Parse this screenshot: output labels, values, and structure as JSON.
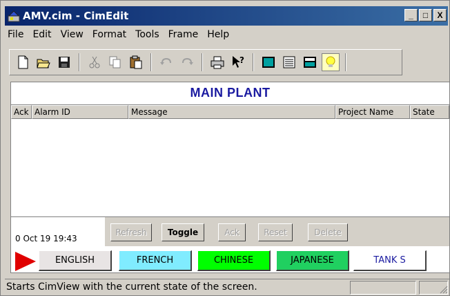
{
  "window": {
    "title": "AMV.cim - CimEdit",
    "min": "_",
    "max": "□",
    "close": "X"
  },
  "menu": [
    "File",
    "Edit",
    "View",
    "Format",
    "Tools",
    "Frame",
    "Help"
  ],
  "toolbar": {
    "icons": [
      "new-file-icon",
      "open-folder-icon",
      "save-disk-icon",
      "cut-icon",
      "copy-icon",
      "paste-icon",
      "undo-icon",
      "redo-icon",
      "print-icon",
      "context-help-icon",
      "screen-icon",
      "list-icon",
      "run-cimview-icon",
      "lightbulb-icon"
    ]
  },
  "plant": {
    "title": "MAIN PLANT"
  },
  "alarm_table": {
    "columns": [
      "Ack",
      "Alarm ID",
      "Message",
      "Project Name",
      "State"
    ],
    "rows": []
  },
  "alarm_controls": {
    "date": "0 Oct 19 19:43",
    "refresh": "Refresh",
    "toggle": "Toggle",
    "ack": "Ack",
    "reset": "Reset",
    "delete": "Delete"
  },
  "languages": {
    "english": "ENGLISH",
    "french": "FRENCH",
    "chinese": "CHINESE",
    "japanese": "JAPANESE",
    "tanks": "TANK S",
    "colors": {
      "english": "#e8e4e4",
      "french": "#80ecff",
      "chinese": "#00ff00",
      "japanese": "#20d060",
      "tanks": "#ffffff"
    }
  },
  "status": {
    "text": "Starts CimView with the current state of the screen."
  }
}
